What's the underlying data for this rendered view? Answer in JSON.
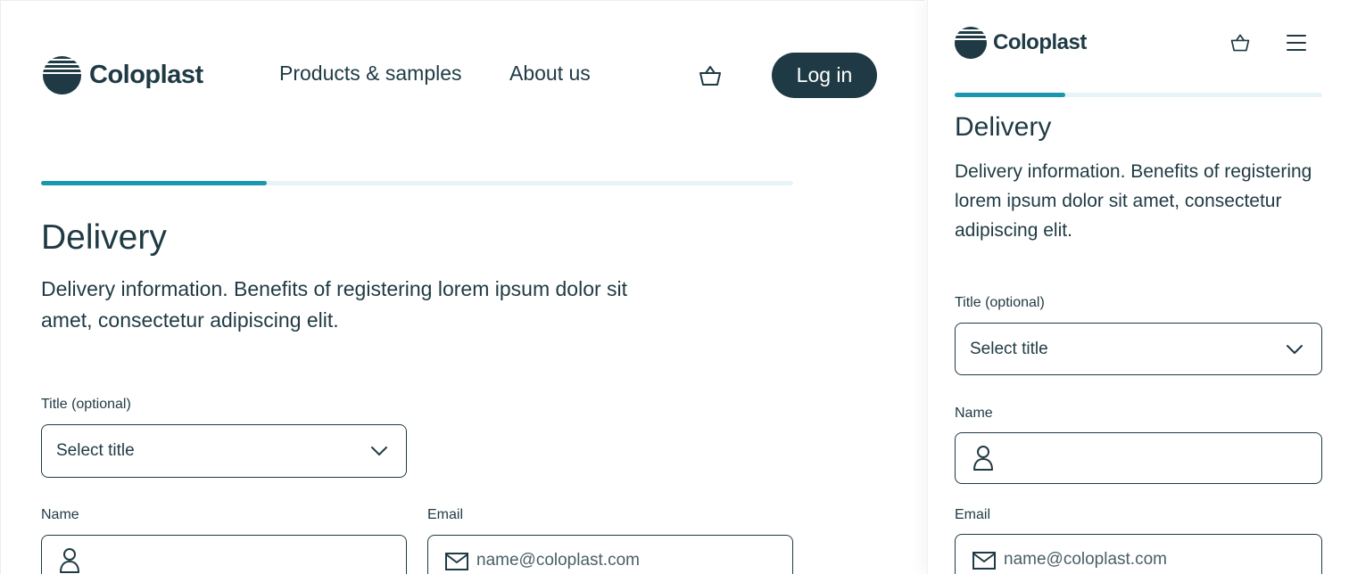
{
  "brand": {
    "name": "Coloplast"
  },
  "colors": {
    "primary": "#1f3a44",
    "accent": "#1a97ae",
    "track": "#e7f4f7"
  },
  "desktop": {
    "nav": {
      "products_label": "Products & samples",
      "about_label": "About us",
      "login_label": "Log in"
    },
    "progress": 0.3
  },
  "mobile": {
    "progress": 0.3
  },
  "form": {
    "heading": "Delivery",
    "intro": "Delivery information. Benefits of registering lorem ipsum dolor sit amet, consectetur adipiscing elit.",
    "title_label": "Title (optional)",
    "title_value": "Select title",
    "name_label": "Name",
    "name_value": "",
    "email_label": "Email",
    "email_placeholder": "name@coloplast.com"
  },
  "icons": {
    "logo": "coloplast-logo-icon",
    "cart": "basket-icon",
    "menu": "hamburger-menu-icon",
    "dropdown": "chevron-down-icon",
    "user": "person-icon",
    "email": "envelope-icon"
  }
}
